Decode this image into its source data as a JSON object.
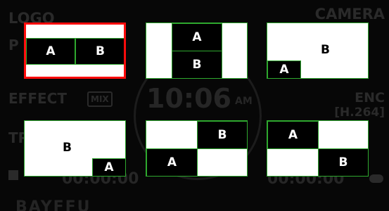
{
  "background_ui": {
    "logo": "LOGO",
    "camera": "CAMERA",
    "p_label": "P",
    "effect": "EFFECT",
    "mix": "MIX",
    "time": "10:06",
    "ampm": "AM",
    "enc": "ENC",
    "codec": "[H.264]",
    "tr_label": "TR",
    "timecode_left": "00:00:00",
    "timecode_right": "00:00:00",
    "bottom_label": "BAYFFU"
  },
  "layouts": [
    {
      "id": "side-by-side",
      "a": "A",
      "b": "B",
      "selected": true
    },
    {
      "id": "top-bottom",
      "a": "A",
      "b": "B",
      "selected": false
    },
    {
      "id": "pip-a-bottom-left",
      "a": "A",
      "b": "B",
      "selected": false
    },
    {
      "id": "pip-a-bottom-right",
      "a": "A",
      "b": "B",
      "selected": false
    },
    {
      "id": "diagonal-b-top-right",
      "a": "A",
      "b": "B",
      "selected": false
    },
    {
      "id": "diagonal-a-top-left",
      "a": "A",
      "b": "B",
      "selected": false
    }
  ],
  "colors": {
    "selected_border": "#ff0c0c",
    "tile_border": "#2ea82e",
    "tile_fill": "#ffffff",
    "block_fill": "#000000"
  }
}
